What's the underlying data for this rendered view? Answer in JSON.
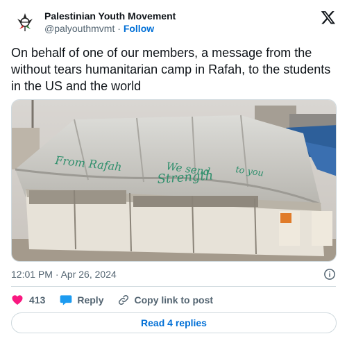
{
  "author": {
    "display_name": "Palestinian Youth Movement",
    "handle": "@palyouthmvmt",
    "separator": " · ",
    "follow_label": "Follow"
  },
  "tweet": {
    "text": "On behalf of one of our members, a message from the without tears humanitarian camp in Rafah, to the students in the US and the world",
    "image_writing_line1": "From Rafah",
    "image_writing_line2": "We send",
    "image_writing_line3": "Strength",
    "image_writing_line4": "to you",
    "timestamp": "12:01 PM · Apr 26, 2024"
  },
  "actions": {
    "like_count": "413",
    "reply_label": "Reply",
    "copy_label": "Copy link to post"
  },
  "read_replies_label": "Read 4 replies",
  "colors": {
    "like": "#f91880",
    "reply": "#1d9bf0",
    "link": "#006fd6",
    "muted": "#536471"
  }
}
